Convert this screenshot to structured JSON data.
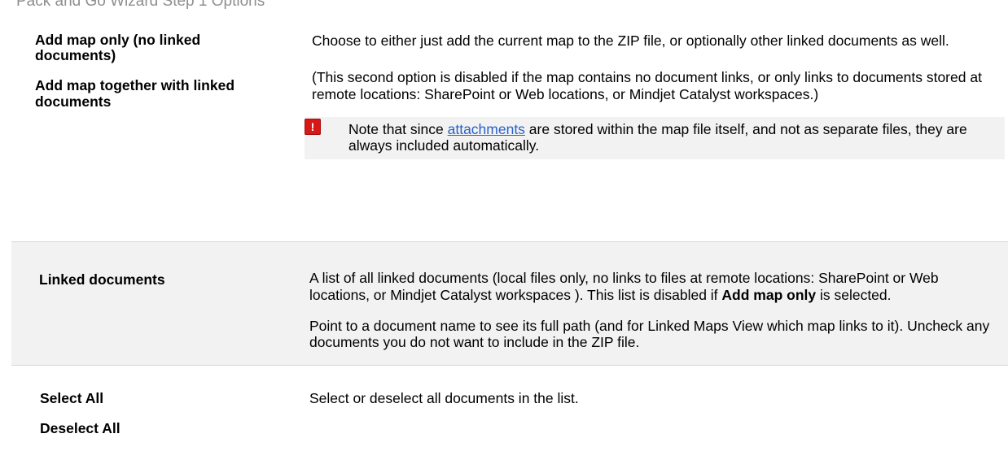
{
  "heading": "Pack and Go Wizard Step 1 Options",
  "rows": [
    {
      "terms": [
        "Add map only (no linked documents)",
        "Add map together with linked documents"
      ],
      "paragraphs": [
        "Choose to either just add the current map to the ZIP file, or optionally other linked documents as well.",
        "(This second option is disabled if the map contains no document links, or only links to documents stored at remote locations: SharePoint or Web locations, or Mindjet Catalyst workspaces.)"
      ],
      "note": {
        "icon": "exclamation-warning-icon",
        "icon_glyph": "!",
        "before": "Note that  since ",
        "link": "attachments",
        "after": " are stored within the map file itself, and not as separate files, they are always included automatically."
      }
    },
    {
      "terms": [
        "Linked documents"
      ],
      "p1_before": "A list of all linked documents (local files only, no links to files at  remote locations: SharePoint or Web locations, or Mindjet Catalyst workspaces ). This list is disabled if ",
      "p1_bold": "Add map only",
      "p1_after": " is selected.",
      "p2": "Point to a document name to see its full path (and for Linked Maps View which map links to it). Uncheck any documents you do not want to include in the ZIP file."
    },
    {
      "terms": [
        "Select All",
        "Deselect All"
      ],
      "paragraphs": [
        "Select or deselect all documents in the list."
      ]
    }
  ],
  "colors": {
    "note_icon": "#d81717",
    "link": "#2862c8",
    "shade": "#f2f2f2",
    "rule": "#d8d8d8",
    "heading": "#8f8f8f"
  }
}
